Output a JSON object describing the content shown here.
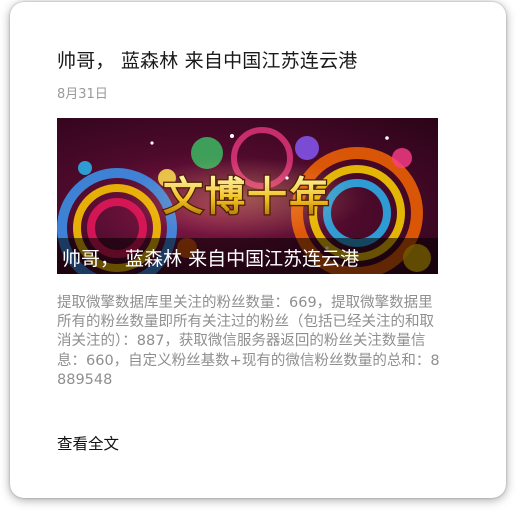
{
  "article": {
    "title": "帅哥， 蓝森林 来自中国江苏连云港",
    "date": "8月31日",
    "cover": {
      "banner_text": "文博十年",
      "caption": "帅哥， 蓝森林 来自中国江苏连云港"
    },
    "summary": "提取微擎数据库里关注的粉丝数量：669，提取微擎数据里所有的粉丝数量即所有关注过的粉丝（包括已经关注的和取消关注的）：887，获取微信服务器返回的粉丝关注数量信息：660，自定义粉丝基数+现有的微信粉丝数量的总和：8889548",
    "read_more": "查看全文"
  },
  "colors": {
    "card_background": "#ffffff",
    "title": "#1a1a1a",
    "muted_text": "#9a9a9a",
    "cover_background": "#4e0a2c"
  }
}
